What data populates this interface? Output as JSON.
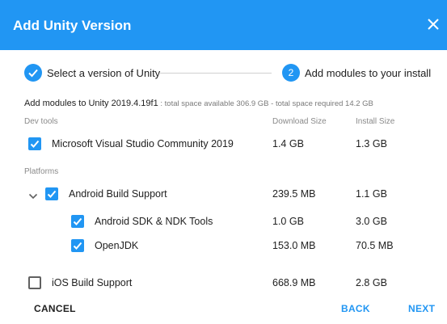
{
  "dialog": {
    "title": "Add Unity Version"
  },
  "stepper": {
    "step1_label": "Select a version of Unity",
    "step2_number": "2",
    "step2_label": "Add modules to your install"
  },
  "summary": {
    "main": "Add modules to Unity 2019.4.19f1",
    "details": " : total space available 306.9 GB - total space required 14.2 GB"
  },
  "columns": {
    "download": "Download Size",
    "install": "Install Size"
  },
  "sections": {
    "dev_tools": "Dev tools",
    "platforms": "Platforms"
  },
  "modules": [
    {
      "name": "Microsoft Visual Studio Community 2019",
      "download": "1.4 GB",
      "install": "1.3 GB",
      "checked": true
    },
    {
      "name": "Android Build Support",
      "download": "239.5 MB",
      "install": "1.1 GB",
      "checked": true,
      "expanded": true
    },
    {
      "name": "Android SDK & NDK Tools",
      "download": "1.0 GB",
      "install": "3.0 GB",
      "checked": true
    },
    {
      "name": "OpenJDK",
      "download": "153.0 MB",
      "install": "70.5 MB",
      "checked": true
    },
    {
      "name": "iOS Build Support",
      "download": "668.9 MB",
      "install": "2.8 GB",
      "checked": false
    }
  ],
  "footer": {
    "cancel": "CANCEL",
    "back": "BACK",
    "next": "NEXT"
  },
  "colors": {
    "accent": "#2196f3"
  }
}
